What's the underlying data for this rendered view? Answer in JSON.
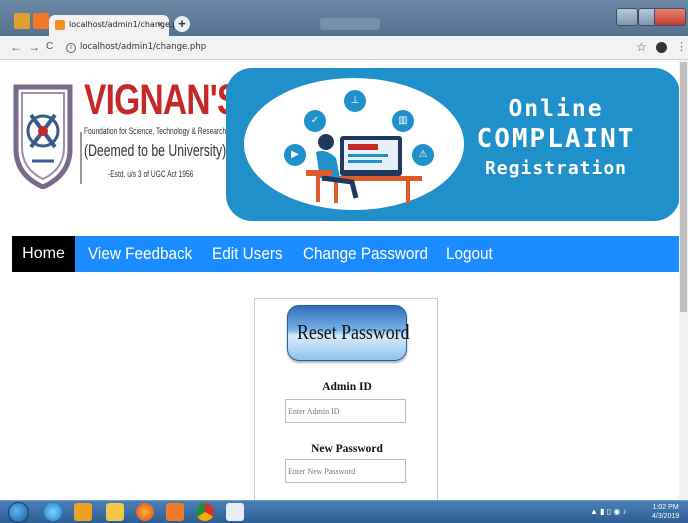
{
  "browser": {
    "tab_title": "localhost/admin1/change.php",
    "tab_close": "×",
    "new_tab": "+",
    "url": "localhost/admin1/change.php",
    "back": "←",
    "forward": "→",
    "reload": "C",
    "info": "i",
    "bookmark": "☆",
    "menu": "⋮"
  },
  "header": {
    "brand_name": "VIGNAN'S",
    "brand_subtitle": "Foundation for Science, Technology & Research",
    "brand_deemed": "(Deemed to be University)",
    "brand_estd": "-Estd. u/s 3 of UGC Act 1956",
    "banner_line1": "Online",
    "banner_line2": "COMPLAINT",
    "banner_line3": "Registration"
  },
  "nav": {
    "items": [
      "Home",
      "View Feedback",
      "Edit Users",
      "Change Password",
      "Logout"
    ]
  },
  "form": {
    "reset_button": "Reset Password",
    "admin_id_label": "Admin ID",
    "admin_id_placeholder": "Enter Admin ID",
    "new_password_label": "New Password",
    "new_password_placeholder": "Enter New Password"
  },
  "taskbar": {
    "clock_time": "1:02 PM",
    "clock_date": "4/3/2019"
  },
  "colors": {
    "nav_bg": "#1a8cff",
    "nav_active": "#000000",
    "banner": "#1f90c9",
    "brand_red": "#c62828"
  },
  "icons": [
    "shield-icon",
    "bookmark-icon",
    "profile-icon",
    "start-icon",
    "chrome-icon",
    "firefox-icon",
    "ie-icon"
  ]
}
